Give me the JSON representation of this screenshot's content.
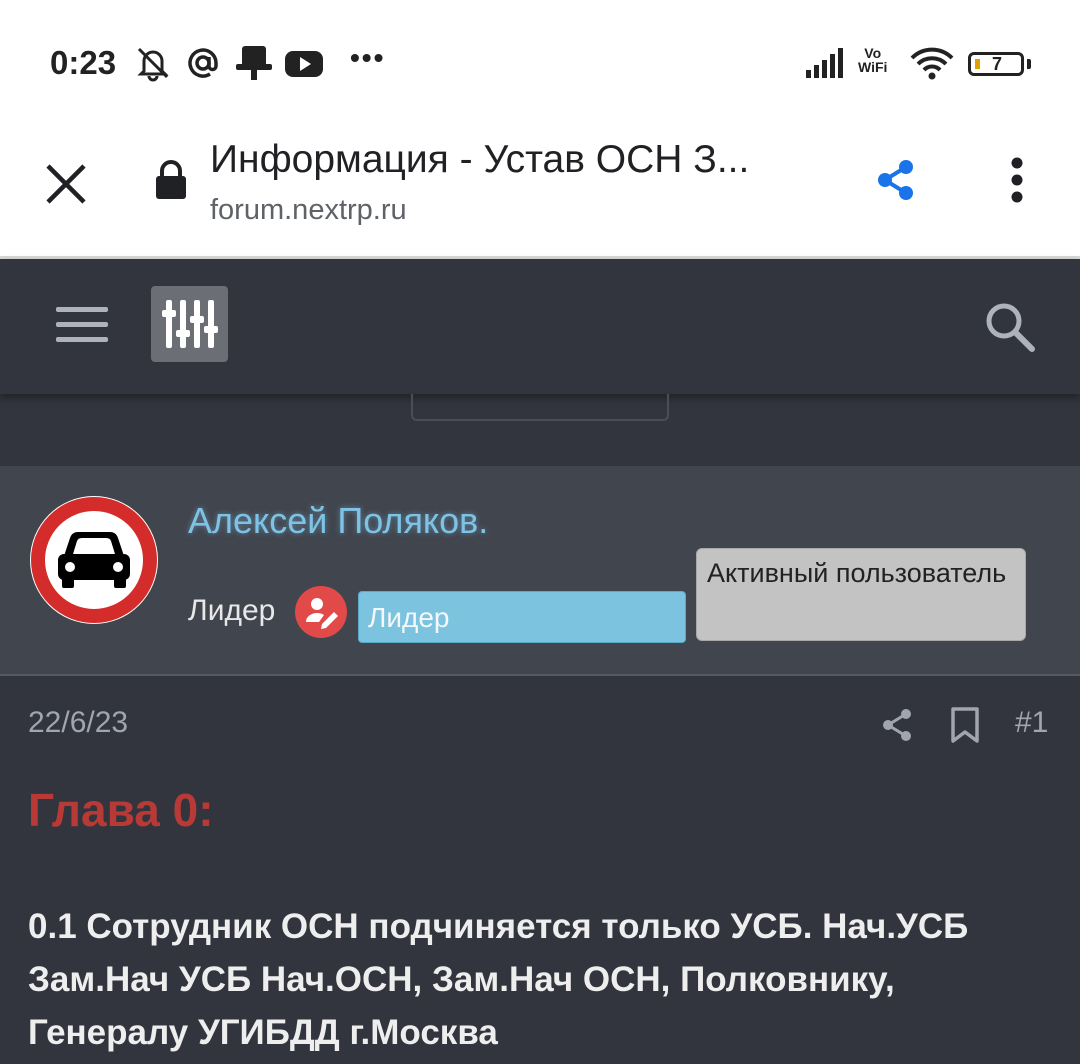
{
  "status_bar": {
    "time": "0:23",
    "battery": "7",
    "vowifi_top": "Vo",
    "vowifi_bottom": "WiFi",
    "icons": [
      "mute-bell-icon",
      "at-icon",
      "cast-icon",
      "youtube-icon",
      "more-dots-icon",
      "signal-icon",
      "vowifi-icon",
      "wifi-icon",
      "battery-icon"
    ]
  },
  "browser": {
    "title": "Информация - Устав ОСН З...",
    "url": "forum.nextrp.ru",
    "accent_color": "#1a73e8"
  },
  "post": {
    "author": "Алексей Поляков.",
    "role": "Лидер",
    "banner_leader": "Лидер",
    "banner_active": "Активный пользователь",
    "date": "22/6/23",
    "number": "#1",
    "chapter": "Глава 0:",
    "body": "0.1 Сотрудник ОСН подчиняется только УСБ. Нач.УСБ Зам.Нач УСБ Нач.ОСН, Зам.Нач ОСН, Полковнику, Генералу УГИБДД г.Москва"
  },
  "colors": {
    "page_bg": "#32353d",
    "username": "#7ec3e6",
    "chapter": "#b83a36",
    "leader_banner": "#7bc3df",
    "active_banner": "#c3c3c3"
  }
}
